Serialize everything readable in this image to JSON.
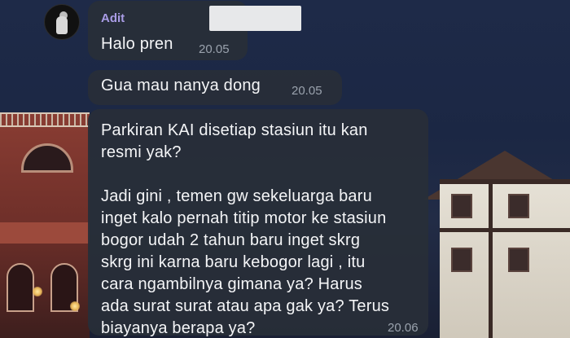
{
  "chat": {
    "sender_name": "Adit",
    "messages": [
      {
        "text": "Halo pren",
        "time": "20.05"
      },
      {
        "text": "Gua mau nanya dong",
        "time": "20.05"
      },
      {
        "text": "Parkiran KAI disetiap stasiun itu kan\nresmi yak?\n\nJadi gini , temen gw sekeluarga baru\ninget kalo pernah titip motor ke stasiun\nbogor udah 2 tahun baru inget skrg\nskrg ini karna baru kebogor lagi , itu\ncara ngambilnya gimana ya? Harus\nada surat surat atau apa gak ya? Terus\nbiayanya berapa ya?",
        "time": "20.06"
      }
    ]
  }
}
